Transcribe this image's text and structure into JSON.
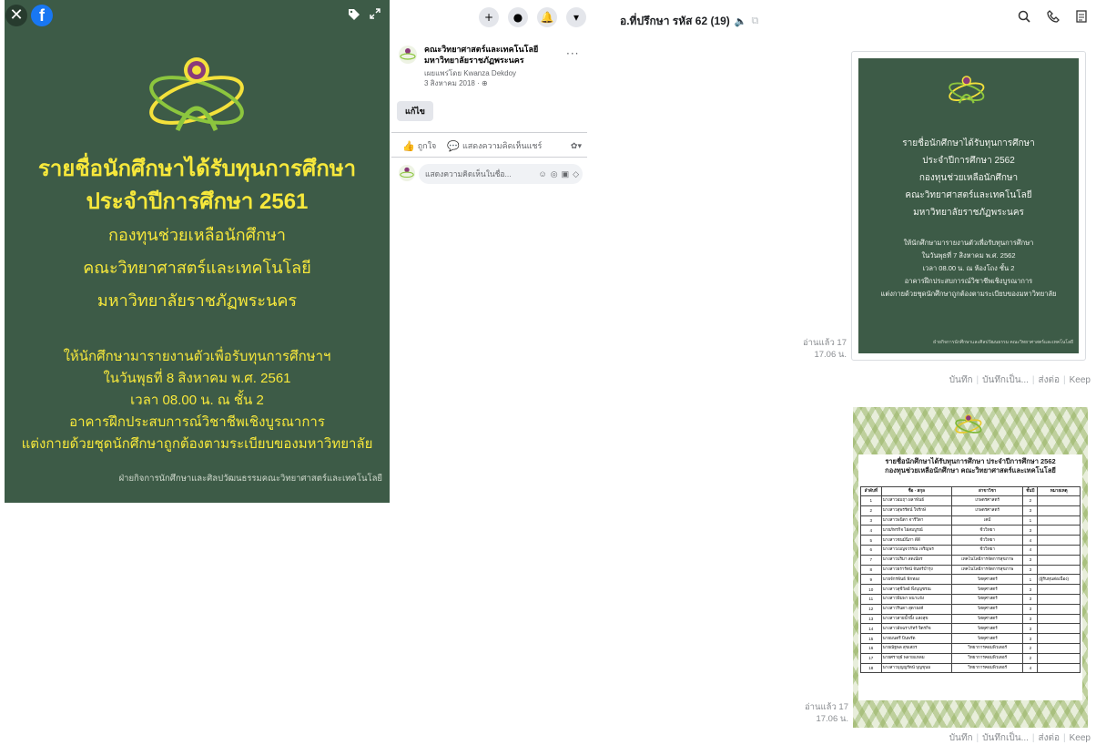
{
  "viewer": {
    "close_icon": "✕",
    "fb_logo": "f",
    "tag_icon": "tag-icon",
    "expand_icon": "expand-icon",
    "poster": {
      "heading": [
        {
          "text": "รายชื่อนักศึกษาได้รับทุนการศึกษา",
          "size": "big"
        },
        {
          "text": "ประจำปีการศึกษา 2561",
          "size": "big"
        },
        {
          "text": "กองทุนช่วยเหลือนักศึกษา",
          "size": "mid"
        },
        {
          "text": "คณะวิทยาศาสตร์และเทคโนโลยี",
          "size": "mid"
        },
        {
          "text": "มหาวิทยาลัยราชภัฏพระนคร",
          "size": "mid"
        }
      ],
      "body": [
        "ให้นักศึกษามารายงานตัวเพื่อรับทุนการศึกษาฯ",
        "ในวันพุธที่ 8 สิงหาคม พ.ศ. 2561",
        "เวลา 08.00 น. ณ ชั้น 2",
        "อาคารฝึกประสบการณ์วิชาชีพเชิงบูรณาการ",
        "แต่งกายด้วยชุดนักศึกษาถูกต้องตามระเบียบของมหาวิทยาลัย"
      ],
      "footer": "ฝ่ายกิจการนักศึกษาและศิลปวัฒนธรรมคณะวิทยาศาสตร์และเทคโนโลยี"
    },
    "colors": {
      "poster_bg": "#3d5b47",
      "poster_text": "#f7e83b"
    }
  },
  "post": {
    "actions": [
      "+",
      "●",
      "🔔",
      "▾"
    ],
    "page_name": "คณะวิทยาศาสตร์และเทคโนโลยี มหาวิทยาลัยราชภัฏพระนคร",
    "posted_by": "เผยแพร่โดย Kwanza Dekdoy",
    "date": "3 สิงหาคม 2018 · ",
    "more": "···",
    "edit_label": "แก้ไข",
    "like_label": "ถูกใจ",
    "comment_label": "แสดงความคิดเห็น",
    "share_label": "แชร์",
    "comment_placeholder": "แสดงความคิดเห็นในชื่อ...",
    "comment_tools": [
      "☺",
      "◎",
      "▣",
      "◇"
    ]
  },
  "chat": {
    "title": "อ.ที่ปรึกษา รหัส 62 (19)",
    "header_icons": [
      "search-icon",
      "phone-icon",
      "note-icon"
    ],
    "messages": [
      {
        "read": "อ่านแล้ว 17",
        "time": "17.06 น.",
        "actions": [
          "บันทึก",
          "บันทึกเป็น...",
          "ส่งต่อ",
          "Keep"
        ],
        "heading": [
          "รายชื่อนักศึกษาได้รับทุนการศึกษา",
          "ประจำปีการศึกษา 2562",
          "กองทุนช่วยเหลือนักศึกษา",
          "คณะวิทยาศาสตร์และเทคโนโลยี",
          "มหาวิทยาลัยราชภัฏพระนคร"
        ],
        "body": [
          "ให้นักศึกษามารายงานตัวเพื่อรับทุนการศึกษา",
          "ในวันพุธที่ 7 สิงหาคม พ.ศ. 2562",
          "เวลา 08.00 น. ณ ห้องโถง ชั้น 2",
          "อาคารฝึกประสบการณ์วิชาชีพเชิงบูรณาการ",
          "แต่งกายด้วยชุดนักศึกษาถูกต้องตามระเบียบของมหาวิทยาลัย"
        ],
        "footer": "ฝ่ายกิจการนักศึกษาและศิลปวัฒนธรรม คณะวิทยาศาสตร์และเทคโนโลยี"
      },
      {
        "read": "อ่านแล้ว 17",
        "time": "17.06 น.",
        "actions": [
          "บันทึก",
          "บันทึกเป็น...",
          "ส่งต่อ",
          "Keep"
        ],
        "title": "รายชื่อนักศึกษาได้รับทุนการศึกษา ประจำปีการศึกษา 2562\nกองทุนช่วยเหลือนักศึกษา คณะวิทยาศาสตร์และเทคโนโลยี",
        "columns": [
          "ลำดับที่",
          "ชื่อ - สกุล",
          "สาขาวิชา",
          "ชั้นปี",
          "หมายเหตุ"
        ],
        "rows": [
          [
            "1",
            "นางสาวอมฤา ผลาพันธ์",
            "เกษตรศาสตร์",
            "2",
            ""
          ],
          [
            "2",
            "นางสาวสุพรรัตน์ ใจรักษ์",
            "เกษตรศาสตร์",
            "3",
            ""
          ],
          [
            "3",
            "นางสาวพนิดา จารีวิดา",
            "เคมี",
            "1",
            ""
          ],
          [
            "4",
            "นายภัทรกิจ ไผ่สมบูรณ์",
            "ชีววิทยา",
            "3",
            ""
          ],
          [
            "5",
            "นางสาวชนม์นิภา ดีดี",
            "ชีววิทยา",
            "4",
            ""
          ],
          [
            "6",
            "นางสาวเบญจวรรณ เจริญพร",
            "ชีววิทยา",
            "4",
            ""
          ],
          [
            "7",
            "นางสาวปริมา สดเนียร",
            "เทคโนโลยีการจัดการสุขภาพ",
            "3",
            ""
          ],
          [
            "8",
            "นางสาวธรารัตน์ จันทร์บำรุง",
            "เทคโนโลยีการจัดการสุขภาพ",
            "3",
            ""
          ],
          [
            "9",
            "นายจักรพันธ์ ฟักทอง",
            "วัสดุศาสตร์",
            "1",
            "(ผู้รับทุนต่อเนื่อง)"
          ],
          [
            "10",
            "นางสาวสุชีวัลย์ พึ่งบุญชรณ",
            "วัสดุศาสตร์",
            "3",
            ""
          ],
          [
            "11",
            "นางสาวพิมพา พนาแจ้ง",
            "วัสดุศาสตร์",
            "3",
            ""
          ],
          [
            "12",
            "นางสาวรินดา สุดายงค์",
            "วัสดุศาสตร์",
            "3",
            ""
          ],
          [
            "13",
            "นางสาวสายน้ำผึ้ง แสงสุข",
            "วัสดุศาสตร์",
            "3",
            ""
          ],
          [
            "14",
            "นางสาวอัจฉราภัทร์ จิตรกิจ",
            "วัสดุศาสตร์",
            "3",
            ""
          ],
          [
            "15",
            "นายมนตรี บินพรัด",
            "วัสดุศาสตร์",
            "3",
            ""
          ],
          [
            "16",
            "นายณัฐพล สุขเสถร",
            "วิทยาการคอมพิวเตอร์",
            "2",
            ""
          ],
          [
            "17",
            "นายศรายุธ์ พลายแหลม",
            "วิทยาการคอมพิวเตอร์",
            "2",
            ""
          ],
          [
            "18",
            "นางสาวบุญญรัตน์ บุญขุนม",
            "วิทยาการคอมพิวเตอร์",
            "4",
            ""
          ]
        ]
      }
    ]
  }
}
